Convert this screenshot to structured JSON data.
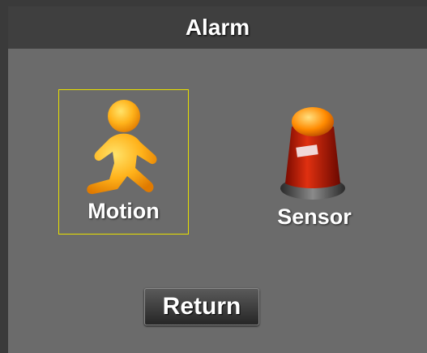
{
  "header": {
    "title": "Alarm"
  },
  "options": [
    {
      "label": "Motion",
      "icon": "running-person-icon",
      "selected": true
    },
    {
      "label": "Sensor",
      "icon": "alarm-beacon-icon",
      "selected": false
    }
  ],
  "footer": {
    "return_label": "Return"
  },
  "colors": {
    "background": "#6b6b6b",
    "title_bar": "#3f3f3f",
    "selection_border": "#e8e000"
  }
}
